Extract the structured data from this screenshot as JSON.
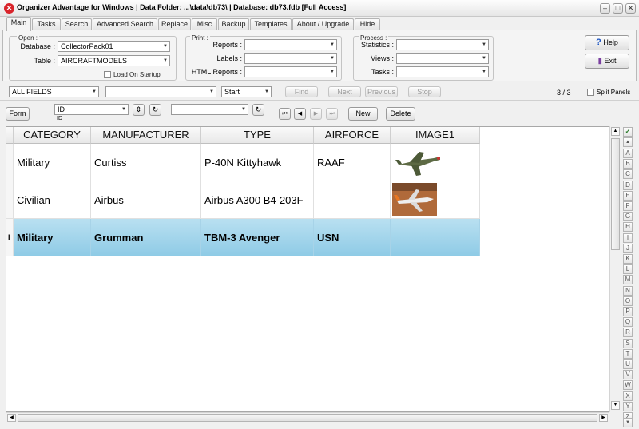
{
  "window": {
    "title": "Organizer Advantage for Windows | Data Folder: ...\\data\\db73\\ | Database: db73.fdb [Full Access]",
    "app_icon_glyph": "✕",
    "minimize": "–",
    "maximize": "□",
    "close": "✕"
  },
  "tabs": [
    "Main",
    "Tasks",
    "Search",
    "Advanced Search",
    "Replace",
    "Misc",
    "Backup",
    "Templates",
    "About / Upgrade",
    "Hide"
  ],
  "open_group": {
    "title": "Open :",
    "database_label": "Database :",
    "database_value": "CollectorPack01",
    "table_label": "Table :",
    "table_value": "AIRCRAFTMODELS",
    "load_on_startup": "Load On Startup"
  },
  "print_group": {
    "title": "Print :",
    "reports_label": "Reports :",
    "labels_label": "Labels :",
    "html_reports_label": "HTML Reports :"
  },
  "process_group": {
    "title": "Process :",
    "statistics_label": "Statistics :",
    "views_label": "Views :",
    "tasks_label": "Tasks :"
  },
  "help_button": "Help",
  "exit_button": "Exit",
  "search_bar": {
    "field_value": "ALL FIELDS",
    "search_value": "",
    "start_value": "Start",
    "find": "Find",
    "next": "Next",
    "previous": "Previous",
    "stop": "Stop",
    "record_count": "3 / 3",
    "split_panels": "Split Panels"
  },
  "toolbar": {
    "form": "Form",
    "sort_field": "ID",
    "sort_sub": "ID",
    "sort_dir_glyph": "⇕",
    "refresh_glyph": "↻",
    "new": "New",
    "delete": "Delete",
    "nav_first": "⏮",
    "nav_prev": "◀",
    "nav_next": "▶",
    "nav_last": "⏭"
  },
  "grid": {
    "columns": [
      "CATEGORY",
      "MANUFACTURER",
      "TYPE",
      "AIRFORCE",
      "IMAGE1"
    ],
    "rows": [
      {
        "category": "Military",
        "manufacturer": "Curtiss",
        "type": "P-40N Kittyhawk",
        "airforce": "RAAF",
        "image": "aircraft-photo-icon"
      },
      {
        "category": "Civilian",
        "manufacturer": "Airbus",
        "type": "Airbus A300 B4-203F",
        "airforce": "",
        "image": "airliner-photo-icon"
      },
      {
        "category": "Military",
        "manufacturer": "Grumman",
        "type": "TBM-3 Avenger",
        "airforce": "USN",
        "image": ""
      }
    ],
    "current_row_marker": "I"
  },
  "alpha_filter": {
    "check": "✓",
    "letters": [
      "A",
      "B",
      "C",
      "D",
      "E",
      "F",
      "G",
      "H",
      "I",
      "J",
      "K",
      "L",
      "M",
      "N",
      "O",
      "P",
      "Q",
      "R",
      "S",
      "T",
      "U",
      "V",
      "W",
      "X",
      "Y",
      "Z"
    ]
  },
  "colors": {
    "selection": "#8fcbe6",
    "accent_red": "#d9242b"
  }
}
